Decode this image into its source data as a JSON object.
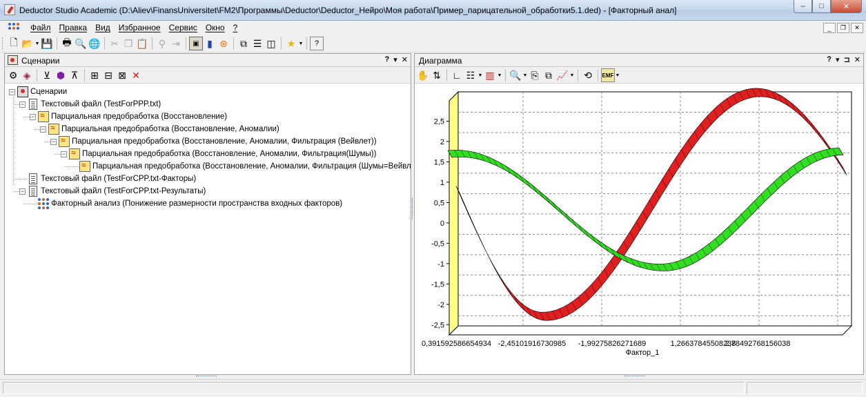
{
  "window": {
    "title": "Deductor Studio Academic (D:\\Aliev\\FinansUniversitet\\FM2\\Программы\\Deductor\\Deductor_Нейро\\Моя работа\\Пример_парицательной_обработки5.1.ded) - [Факторный анал]",
    "min_label": "–",
    "max_label": "□",
    "close_label": "✕"
  },
  "menu": {
    "items": [
      "Файл",
      "Правка",
      "Вид",
      "Избранное",
      "Сервис",
      "Окно",
      "?"
    ]
  },
  "mdi": {
    "min": "_",
    "restore": "❐",
    "close": "✕"
  },
  "left_panel": {
    "title": "Сценарии",
    "ctrl": [
      "?",
      "▾",
      "✕"
    ],
    "tree": [
      {
        "label": "Сценарии",
        "icon": "scenario-icon",
        "level": 0
      },
      {
        "label": "Текстовый файл (TestForPPP.txt)",
        "icon": "text-file-icon",
        "level": 1
      },
      {
        "label": "Парциальная предобработка (Восстановление)",
        "icon": "preprocess-icon",
        "level": 2
      },
      {
        "label": "Парциальная предобработка (Восстановление, Аномалии)",
        "icon": "preprocess-icon",
        "level": 3
      },
      {
        "label": "Парциальная предобработка (Восстановление, Аномалии, Фильтрация (Вейвлет))",
        "icon": "preprocess-icon",
        "level": 4
      },
      {
        "label": "Парциальная предобработка (Восстановление, Аномалии, Фильтрация(Шумы))",
        "icon": "preprocess-icon",
        "level": 5
      },
      {
        "label": "Парциальная предобработка (Восстановление, Аномалии, Фильтрация (Шумы=Вейвлет))",
        "icon": "preprocess-icon",
        "level": 6
      },
      {
        "label": "Текстовый файл (TestForCPP.txt-Факторы)",
        "icon": "text-file-icon",
        "level": 1
      },
      {
        "label": "Текстовый файл (TestForCPP.txt-Результаты)",
        "icon": "text-file-icon",
        "level": 1
      },
      {
        "label": "Факторный анализ (Понижение размерности пространства входных факторов)",
        "icon": "factor-analysis-icon",
        "level": 2
      }
    ]
  },
  "right_panel": {
    "title": "Диаграмма",
    "ctrl": [
      "?",
      "▾",
      "⊐",
      "✕"
    ]
  },
  "chart_data": {
    "type": "line",
    "xlabel": "Фактор_1",
    "ylabel": "",
    "x_ticks": [
      "0,391592586654934",
      "-2,45101916730985",
      "-1,99275826271689",
      "1,26637845508238",
      "2,78492768156038"
    ],
    "y_ticks": [
      "2,5",
      "2",
      "1,5",
      "1",
      "0,5",
      "0",
      "-0,5",
      "-1",
      "-1,5",
      "-2",
      "-2,5"
    ],
    "ylim": [
      -2.75,
      3.0
    ],
    "grid": true,
    "colors": {
      "series1": "#e02020",
      "series2": "#33dd22",
      "wall": "#ffff88"
    },
    "series": [
      {
        "values": [
          0.55,
          -2.55,
          2.95,
          0.7
        ]
      },
      {
        "values": [
          1.45,
          -1.35,
          1.5
        ]
      }
    ]
  }
}
